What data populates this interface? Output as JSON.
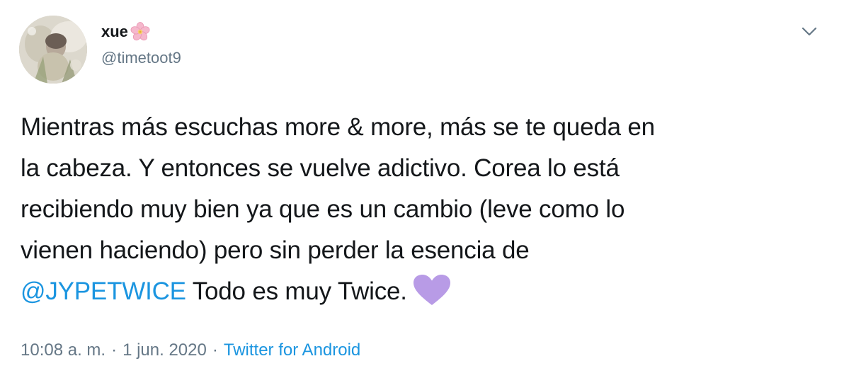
{
  "tweet": {
    "display_name": "xue",
    "name_emoji": "cherry-blossom-icon",
    "handle": "@timetoot9",
    "lines": [
      "Mientras más escuchas more & more, más se te queda en",
      "la cabeza. Y entonces se vuelve adictivo. Corea lo está",
      "recibiendo muy bien ya que es un cambio (leve como lo",
      "vienen haciendo) pero sin perder la esencia de"
    ],
    "mention": "@JYPETWICE",
    "last_line_text": " Todo es muy Twice.",
    "trailing_emoji": "purple-heart-icon",
    "time": "10:08 a. m.",
    "separator": "·",
    "date": "1 jun. 2020",
    "source": "Twitter for Android"
  },
  "colors": {
    "text": "#14171a",
    "secondary": "#657786",
    "link": "#1b95e0",
    "heart": "#b89be6",
    "background": "#ffffff"
  }
}
